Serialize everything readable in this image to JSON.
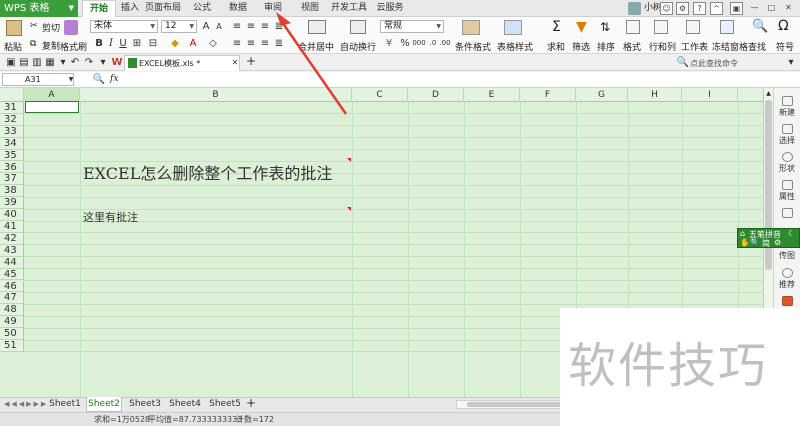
{
  "app": {
    "name": "WPS 表格",
    "accent": "#3a9f3a"
  },
  "menu": {
    "tabs": [
      "开始",
      "插入",
      "页面布局",
      "公式",
      "数据",
      "审阅",
      "视图",
      "开发工具",
      "云服务"
    ],
    "active": "开始"
  },
  "user": {
    "name": "小树"
  },
  "ribbon": {
    "clipboard": {
      "paste": "粘贴",
      "cut": "剪切",
      "copy": "复制",
      "format_painter": "格式刷"
    },
    "font": {
      "family": "宋体",
      "size": "12"
    },
    "number_format": "常规",
    "merge_center": "合并居中",
    "wrap_text": "自动换行",
    "cond_format": "条件格式",
    "table_style": "表格样式",
    "sum": "求和",
    "filter": "筛选",
    "sort": "排序",
    "format": "格式",
    "rows_cols": "行和列",
    "worksheet": "工作表",
    "freeze": "冻结窗格",
    "find": "查找",
    "symbol": "符号"
  },
  "document": {
    "tab_title": "EXCEL模板.xls *"
  },
  "search_hint": "点此查找命令",
  "formula_bar": {
    "name_box": "A31",
    "fx": "fx",
    "content": ""
  },
  "grid": {
    "columns": [
      "A",
      "B",
      "C",
      "D",
      "E",
      "F",
      "G",
      "H",
      "I"
    ],
    "rows": [
      "31",
      "32",
      "33",
      "34",
      "35",
      "36",
      "37",
      "38",
      "39",
      "40",
      "41",
      "42",
      "43",
      "44",
      "45",
      "46",
      "47",
      "48",
      "49",
      "50",
      "51"
    ],
    "cell_title": "EXCEL怎么删除整个工作表的批注",
    "cell_comment": "这里有批注"
  },
  "right_panel": [
    "新建",
    "选择",
    "形状",
    "属性",
    "",
    "传图",
    "推荐",
    ""
  ],
  "ime": {
    "name": "五笔拼音",
    "mode": "简"
  },
  "sheets": [
    "Sheet1",
    "Sheet2",
    "Sheet3",
    "Sheet4",
    "Sheet5"
  ],
  "active_sheet": "Sheet2",
  "status": {
    "sum": "求和=1万0528",
    "avg": "平均值=87.7333333333",
    "count": "计数=172"
  },
  "watermark": "软件技巧"
}
